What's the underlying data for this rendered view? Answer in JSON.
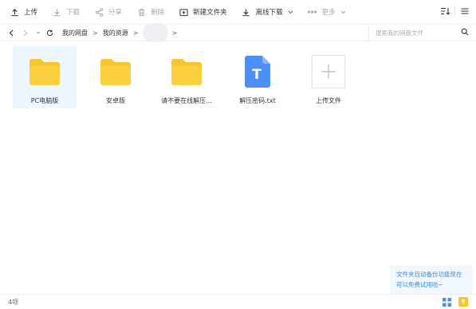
{
  "toolbar": {
    "upload": "上传",
    "download": "下载",
    "share": "分享",
    "delete": "删除",
    "new_folder": "新建文件夹",
    "offline_download": "离线下载",
    "more": "更多"
  },
  "breadcrumb": {
    "root": "我的网盘",
    "resources": "我的资源",
    "sep": ">"
  },
  "search": {
    "placeholder": "搜索我的网盘文件"
  },
  "files": [
    {
      "name": "PC电脑版",
      "type": "folder"
    },
    {
      "name": "安卓版",
      "type": "folder"
    },
    {
      "name": "请不要在线解压...",
      "type": "folder"
    },
    {
      "name": "解压密码.txt",
      "type": "txt",
      "glyph": "T"
    },
    {
      "name": "上传文件",
      "type": "upload"
    }
  ],
  "promo": {
    "line1": "文件夹自动备份功能现在",
    "line2": "可以免费试用啦~"
  },
  "status": {
    "count": "4项"
  },
  "colors": {
    "folder": "#f7c531",
    "txt_icon": "#4d8ff8",
    "accent": "#3a8bd6"
  }
}
